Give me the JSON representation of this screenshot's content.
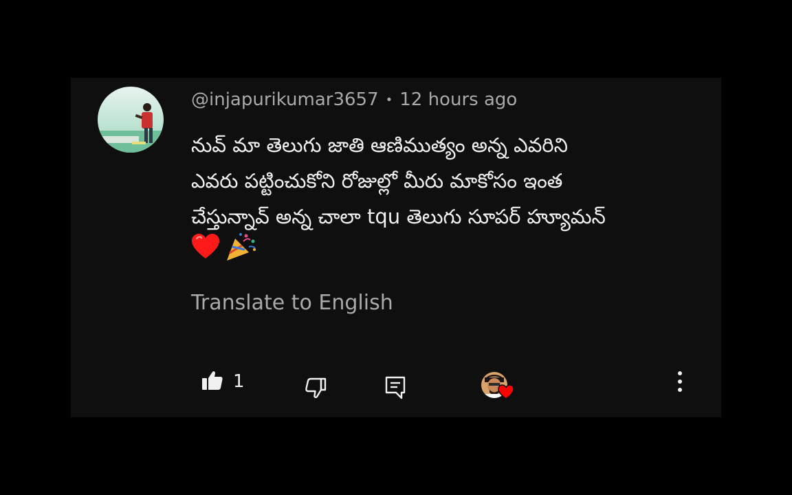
{
  "comment": {
    "author": "@injapurikumar3657",
    "separator": "•",
    "timestamp": "12 hours ago",
    "lines": [
      "నువ్ మా తెలుగు జాతి ఆణిముత్యం అన్న ఎవరిని",
      "ఎవరు పట్టించుకోని రోజుల్లో మీరు మాకోసం ఇంత",
      "చేస్తున్నావ్ అన్న చాలా tqu తెలుగు సూపర్ హ్యూమన్"
    ],
    "emojis": [
      "❤️",
      "🎉"
    ],
    "translate_label": "Translate to English"
  },
  "actions": {
    "like_count": "1",
    "like_icon": "thumbs-up-icon",
    "dislike_icon": "thumbs-down-icon",
    "reply_icon": "reply-comment-icon",
    "creator_heart_icon": "creator-heart-icon",
    "more_icon": "more-vertical-icon"
  },
  "colors": {
    "background": "#000000",
    "card": "#0f0f0f",
    "text_primary": "#f1f1f1",
    "text_secondary": "#aaaaaa",
    "heart_red": "#ff0000"
  }
}
